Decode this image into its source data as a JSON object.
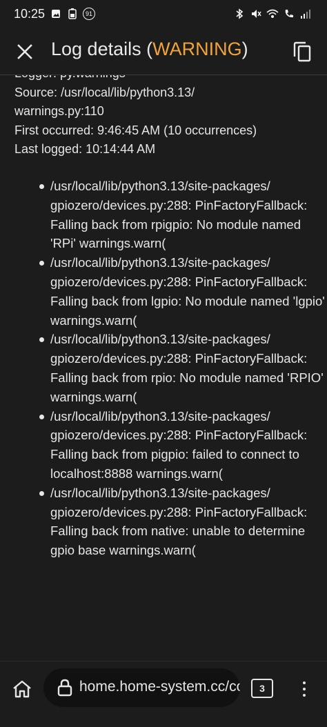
{
  "status_bar": {
    "time": "10:25",
    "notification_badge": "91",
    "left_icons": [
      "image-icon",
      "battery-saver-icon",
      "notification-count-icon"
    ],
    "right_icons": [
      "bluetooth-icon",
      "mute-icon",
      "wifi-call-icon",
      "call-icon",
      "signal-icon"
    ]
  },
  "dialog": {
    "title_prefix": "Log details (",
    "severity": "WARNING",
    "title_suffix": ")",
    "severity_color": "#f2a33a"
  },
  "meta": {
    "logger": "Logger: py.warnings",
    "source_line1": "Source: /usr/local/lib/python3.13/",
    "source_line2": "warnings.py:110",
    "first_occurred": "First occurred: 9:46:45 AM (10 occurrences)",
    "last_logged": "Last logged: 10:14:44 AM"
  },
  "messages": [
    "/usr/local/lib/python3.13/site-packages/ gpiozero/devices.py:288: PinFactoryFallback: Falling back from rpigpio: No module named 'RPi' warnings.warn(",
    "/usr/local/lib/python3.13/site-packages/ gpiozero/devices.py:288: PinFactoryFallback: Falling back from lgpio: No module named 'lgpio' warnings.warn(",
    "/usr/local/lib/python3.13/site-packages/ gpiozero/devices.py:288: PinFactoryFallback: Falling back from rpio: No module named 'RPIO' warnings.warn(",
    "/usr/local/lib/python3.13/site-packages/ gpiozero/devices.py:288: PinFactoryFallback: Falling back from pigpio: failed to connect to localhost:8888 warnings.warn(",
    "/usr/local/lib/python3.13/site-packages/ gpiozero/devices.py:288: PinFactoryFallback: Falling back from native: unable to determine gpio base warnings.warn("
  ],
  "browser": {
    "url": "home.home-system.cc/co",
    "tab_count": "3"
  }
}
